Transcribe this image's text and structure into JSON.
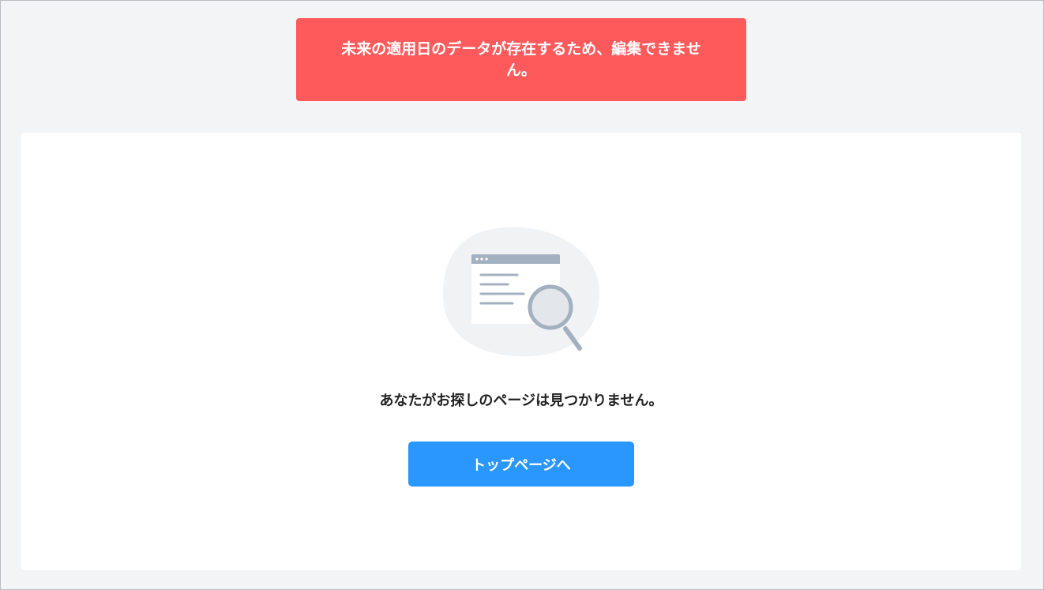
{
  "error_toast": {
    "message": "未来の適用日のデータが存在するため、編集できません。"
  },
  "not_found": {
    "message": "あなたがお探しのページは見つかりません。",
    "illustration_icon": "browser-window-search-icon"
  },
  "actions": {
    "top_page_label": "トップページへ"
  },
  "colors": {
    "error_background": "#fe5a5c",
    "primary_button": "#2a97ff",
    "page_background": "#f3f4f6",
    "card_background": "#ffffff",
    "illustration_gray": "#a3b0bf"
  }
}
